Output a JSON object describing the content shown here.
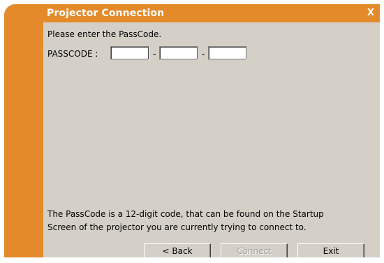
{
  "window": {
    "title": "Projector Connection",
    "close_label": "X"
  },
  "main": {
    "prompt": "Please enter the PassCode.",
    "passcode_label": "PASSCODE :",
    "separator": "-",
    "fields": [
      {
        "value": ""
      },
      {
        "value": ""
      },
      {
        "value": ""
      }
    ],
    "help_line1": "The PassCode is a 12-digit code, that can be found on the Startup",
    "help_line2": "Screen of the projector you are currently trying to connect to."
  },
  "buttons": {
    "back": "< Back",
    "connect": "Connect",
    "exit": "Exit"
  },
  "colors": {
    "accent_orange": "#e48a2b",
    "panel_gray": "#d4d0c8"
  }
}
